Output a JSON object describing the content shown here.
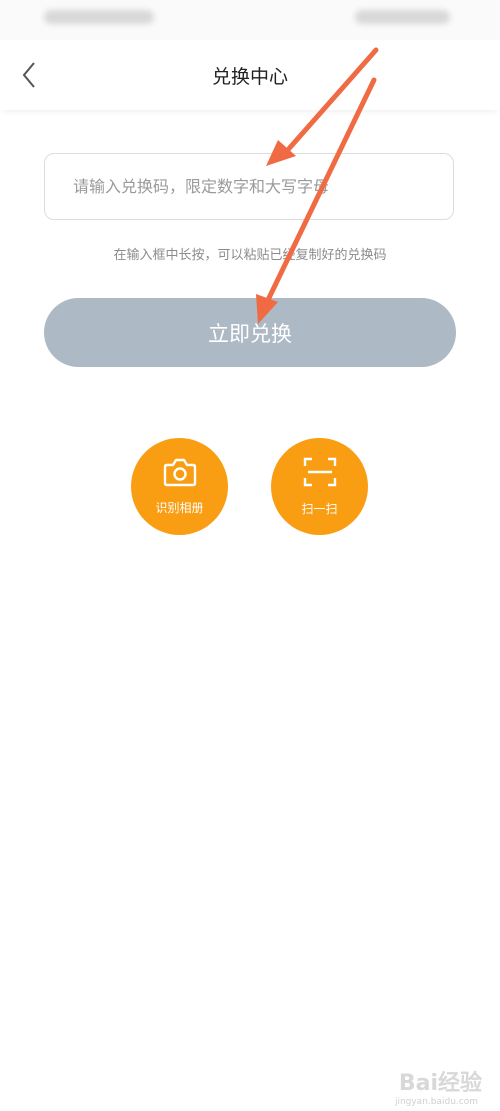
{
  "header": {
    "title": "兑换中心"
  },
  "redeem_input": {
    "value": "",
    "placeholder": "请输入兑换码，限定数字和大写字母"
  },
  "hint": "在输入框中长按，可以粘贴已经复制好的兑换码",
  "redeem_button": {
    "label": "立即兑换"
  },
  "actions": {
    "album": {
      "label": "识别相册",
      "icon": "camera-icon"
    },
    "scan": {
      "label": "扫一扫",
      "icon": "scan-icon"
    }
  },
  "watermark": {
    "text": "Bai经验",
    "sub": "jingyan.baidu.com"
  },
  "colors": {
    "accent_orange": "#f99d12",
    "button_disabled": "#aeb9c6",
    "annotation_arrow": "#f06b43"
  }
}
